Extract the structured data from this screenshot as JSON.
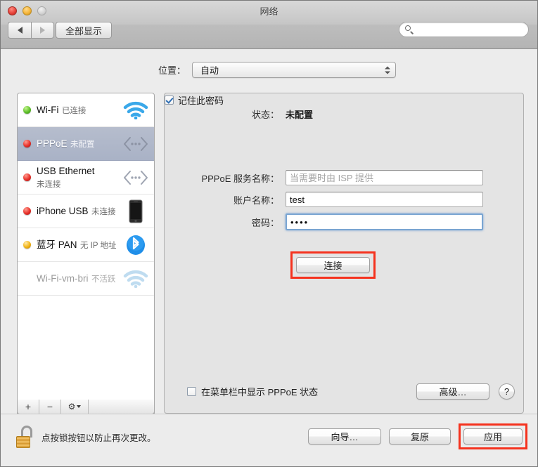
{
  "window": {
    "title": "网络",
    "traffic_lights": [
      "close",
      "minimize",
      "zoom"
    ]
  },
  "toolbar": {
    "back_label": "◀",
    "forward_label": "▶",
    "show_all_label": "全部显示",
    "search_placeholder": "",
    "search_value": ""
  },
  "location": {
    "label": "位置：",
    "selected": "自动"
  },
  "sidebar": {
    "items": [
      {
        "name": "Wi-Fi",
        "status": "已连接",
        "dot": "green",
        "icon": "wifi-icon",
        "state": "normal"
      },
      {
        "name": "PPPoE",
        "status": "未配置",
        "dot": "red",
        "icon": "ethernet-arrows-icon",
        "state": "selected"
      },
      {
        "name": "USB Ethernet",
        "status": "未连接",
        "dot": "red",
        "icon": "ethernet-arrows-icon",
        "state": "normal"
      },
      {
        "name": "iPhone USB",
        "status": "未连接",
        "dot": "red",
        "icon": "iphone-icon",
        "state": "normal"
      },
      {
        "name": "蓝牙 PAN",
        "status": "无 IP 地址",
        "dot": "yellow",
        "icon": "bluetooth-icon",
        "state": "normal"
      },
      {
        "name": "Wi-Fi-vm-bri",
        "status": "不活跃",
        "dot": "none",
        "icon": "wifi-icon",
        "state": "inactive"
      }
    ],
    "toolbar": {
      "add_label": "+",
      "remove_label": "−",
      "gear_label": "gear-icon"
    }
  },
  "main": {
    "status_label": "状态：",
    "status_value": "未配置",
    "service_name_label": "PPPoE 服务名称：",
    "service_name_value": "",
    "service_name_placeholder": "当需要时由 ISP 提供",
    "account_label": "账户名称：",
    "account_value": "test",
    "password_label": "密码：",
    "password_value": "••••",
    "remember_label": "记住此密码",
    "remember_checked": true,
    "connect_label": "连接",
    "show_status_label": "在菜单栏中显示 PPPoE 状态",
    "show_status_checked": false,
    "advanced_label": "高级…",
    "help_label": "?"
  },
  "footer": {
    "lock_text": "点按锁按钮以防止再次更改。",
    "assistant_label": "向导…",
    "revert_label": "复原",
    "apply_label": "应用"
  },
  "colors": {
    "highlight": "#f5321e",
    "selection": "#aeb6c8",
    "accent_blue": "#2f6fb5"
  }
}
